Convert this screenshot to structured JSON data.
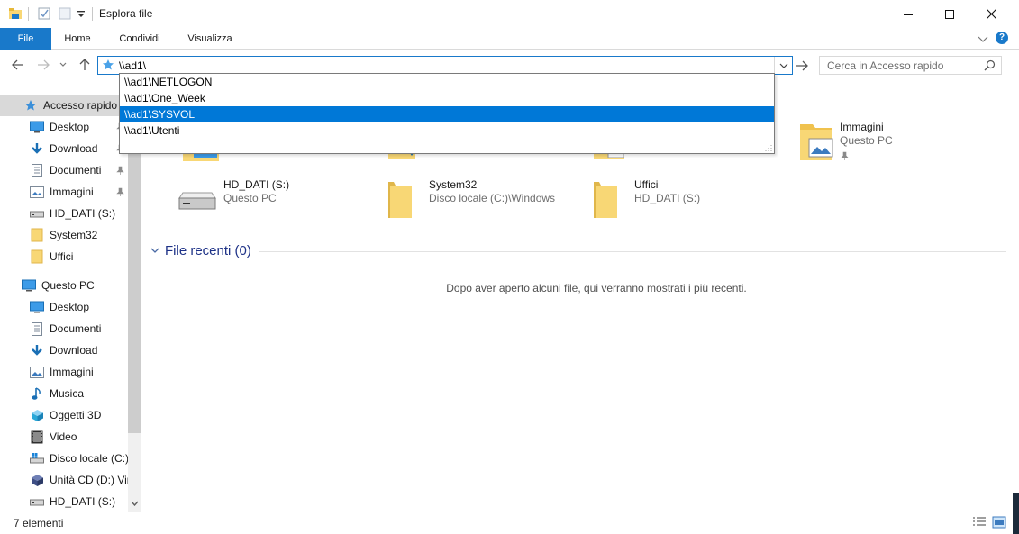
{
  "window": {
    "title": "Esplora file"
  },
  "ribbon": {
    "tabs": [
      "File",
      "Home",
      "Condividi",
      "Visualizza"
    ]
  },
  "address": {
    "value": "\\\\ad1\\"
  },
  "search": {
    "placeholder": "Cerca in Accesso rapido"
  },
  "suggestions": {
    "items": [
      "\\\\ad1\\NETLOGON",
      "\\\\ad1\\One_Week",
      "\\\\ad1\\SYSVOL",
      "\\\\ad1\\Utenti"
    ],
    "highlighted": "\\\\ad1\\SYSVOL"
  },
  "sidebar": {
    "quick_access": "Accesso rapido",
    "quick_items": [
      "Desktop",
      "Download",
      "Documenti",
      "Immagini",
      "HD_DATI (S:)",
      "System32",
      "Uffici"
    ],
    "this_pc": "Questo PC",
    "pc_items": [
      "Desktop",
      "Documenti",
      "Download",
      "Immagini",
      "Musica",
      "Oggetti 3D",
      "Video",
      "Disco locale (C:)",
      "Unità CD (D:) Vir",
      "HD_DATI (S:)"
    ]
  },
  "main": {
    "tiles": [
      {
        "name": "Immagini",
        "sub": "Questo PC",
        "icon": "pictures-folder-icon"
      },
      {
        "name": "HD_DATI (S:)",
        "sub": "Questo PC",
        "icon": "drive-icon"
      },
      {
        "name": "System32",
        "sub": "Disco locale (C:)\\Windows",
        "icon": "folder-icon"
      },
      {
        "name": "Uffici",
        "sub": "HD_DATI (S:)",
        "icon": "folder-icon"
      }
    ],
    "recent_title": "File recenti (0)",
    "recent_empty": "Dopo aver aperto alcuni file, qui verranno mostrati i più recenti."
  },
  "status": {
    "items_count": "7 elementi"
  },
  "colors": {
    "accent": "#1979ca",
    "selection": "#0078d7",
    "folder": "#f8d775",
    "section_title": "#1e3287"
  }
}
